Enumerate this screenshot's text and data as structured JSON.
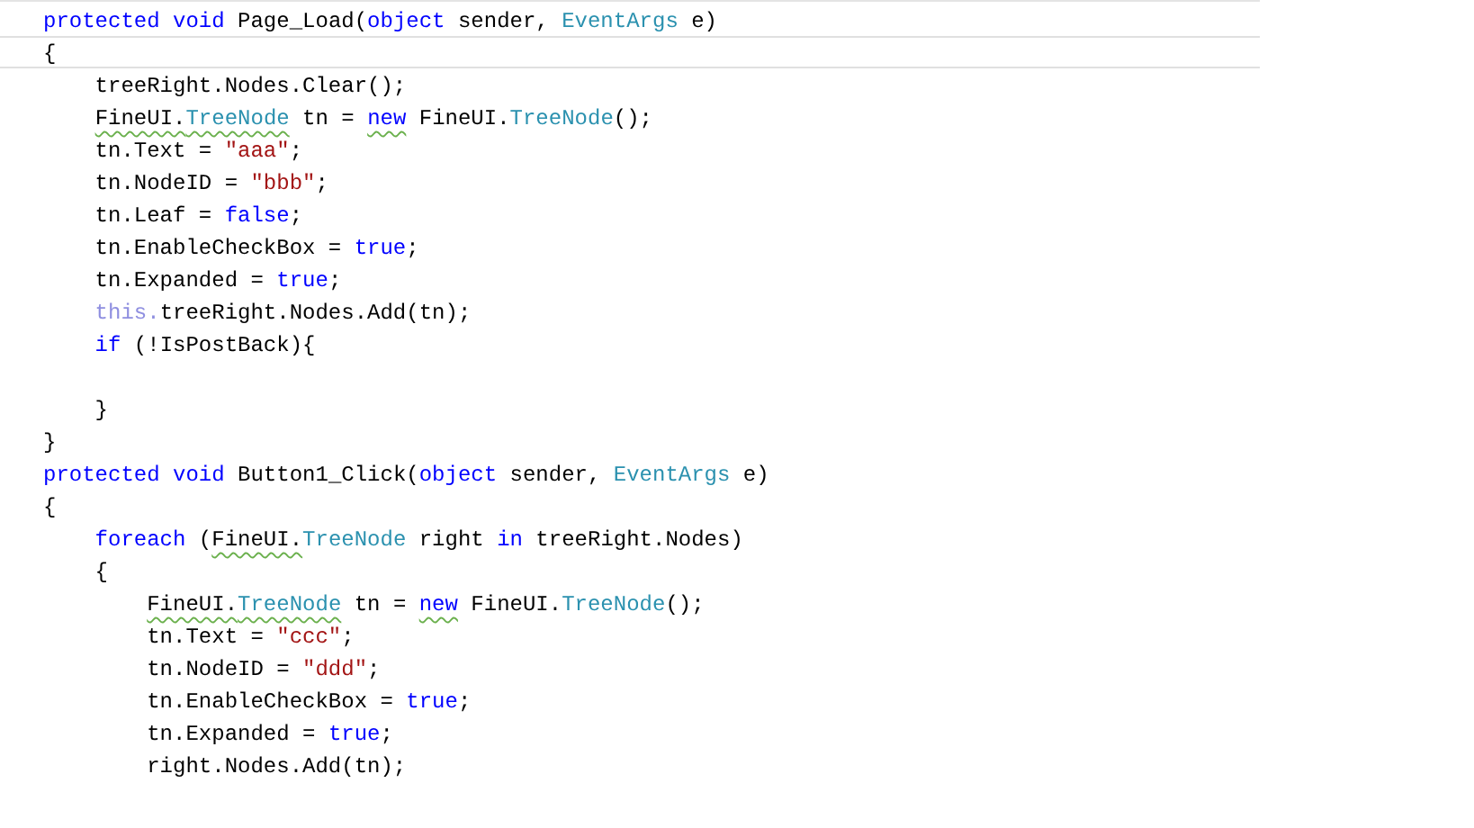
{
  "editor": {
    "lines": [
      {
        "kind": "code",
        "current": false,
        "tokens": [
          {
            "text": "protected void",
            "kind": "keyword"
          },
          {
            "text": " Page_Load(",
            "kind": "plain"
          },
          {
            "text": "object",
            "kind": "keyword"
          },
          {
            "text": " sender, ",
            "kind": "plain"
          },
          {
            "text": "EventArgs",
            "kind": "type"
          },
          {
            "text": " e)",
            "kind": "plain"
          }
        ]
      },
      {
        "kind": "code",
        "current": true,
        "tokens": [
          {
            "text": "{",
            "kind": "plain"
          }
        ]
      },
      {
        "kind": "code",
        "current": false,
        "tokens": [
          {
            "text": "    treeRight.Nodes.Clear();",
            "kind": "plain"
          }
        ]
      },
      {
        "kind": "code",
        "current": false,
        "tokens": [
          {
            "text": "    FineUI.",
            "kind": "plain",
            "squiggle": true
          },
          {
            "text": "TreeNode",
            "kind": "type",
            "squiggle": true
          },
          {
            "text": " tn = ",
            "kind": "plain"
          },
          {
            "text": "new",
            "kind": "keyword",
            "squiggle": true
          },
          {
            "text": " FineUI.",
            "kind": "plain"
          },
          {
            "text": "TreeNode",
            "kind": "type"
          },
          {
            "text": "();",
            "kind": "plain"
          }
        ]
      },
      {
        "kind": "code",
        "current": false,
        "tokens": [
          {
            "text": "    tn.Text = ",
            "kind": "plain"
          },
          {
            "text": "\"aaa\"",
            "kind": "string"
          },
          {
            "text": ";",
            "kind": "plain"
          }
        ]
      },
      {
        "kind": "code",
        "current": false,
        "tokens": [
          {
            "text": "    tn.NodeID = ",
            "kind": "plain"
          },
          {
            "text": "\"bbb\"",
            "kind": "string"
          },
          {
            "text": ";",
            "kind": "plain"
          }
        ]
      },
      {
        "kind": "code",
        "current": false,
        "tokens": [
          {
            "text": "    tn.Leaf = ",
            "kind": "plain"
          },
          {
            "text": "false",
            "kind": "keyword"
          },
          {
            "text": ";",
            "kind": "plain"
          }
        ]
      },
      {
        "kind": "code",
        "current": false,
        "tokens": [
          {
            "text": "    tn.EnableCheckBox = ",
            "kind": "plain"
          },
          {
            "text": "true",
            "kind": "keyword"
          },
          {
            "text": ";",
            "kind": "plain"
          }
        ]
      },
      {
        "kind": "code",
        "current": false,
        "tokens": [
          {
            "text": "    tn.Expanded = ",
            "kind": "plain"
          },
          {
            "text": "true",
            "kind": "keyword"
          },
          {
            "text": ";",
            "kind": "plain"
          }
        ]
      },
      {
        "kind": "code",
        "current": false,
        "tokens": [
          {
            "text": "    this.",
            "kind": "faded"
          },
          {
            "text": "treeRight.Nodes.Add(tn);",
            "kind": "plain"
          }
        ]
      },
      {
        "kind": "code",
        "current": false,
        "tokens": [
          {
            "text": "    if",
            "kind": "keyword"
          },
          {
            "text": " (!IsPostBack){",
            "kind": "plain"
          }
        ]
      },
      {
        "kind": "blank"
      },
      {
        "kind": "code",
        "current": false,
        "tokens": [
          {
            "text": "    }",
            "kind": "plain"
          }
        ]
      },
      {
        "kind": "code",
        "current": false,
        "tokens": [
          {
            "text": "}",
            "kind": "plain"
          }
        ]
      },
      {
        "kind": "code",
        "current": false,
        "tokens": [
          {
            "text": "protected void",
            "kind": "keyword"
          },
          {
            "text": " Button1_Click(",
            "kind": "plain"
          },
          {
            "text": "object",
            "kind": "keyword"
          },
          {
            "text": " sender, ",
            "kind": "plain"
          },
          {
            "text": "EventArgs",
            "kind": "type"
          },
          {
            "text": " e)",
            "kind": "plain"
          }
        ]
      },
      {
        "kind": "code",
        "current": false,
        "tokens": [
          {
            "text": "{",
            "kind": "plain"
          }
        ]
      },
      {
        "kind": "code",
        "current": false,
        "tokens": [
          {
            "text": "    foreach",
            "kind": "keyword"
          },
          {
            "text": " (",
            "kind": "plain"
          },
          {
            "text": "FineUI.",
            "kind": "plain",
            "squiggle": true
          },
          {
            "text": "TreeNode",
            "kind": "type"
          },
          {
            "text": " right ",
            "kind": "plain"
          },
          {
            "text": "in",
            "kind": "keyword"
          },
          {
            "text": " treeRight.Nodes)",
            "kind": "plain"
          }
        ]
      },
      {
        "kind": "code",
        "current": false,
        "tokens": [
          {
            "text": "    {",
            "kind": "plain"
          }
        ]
      },
      {
        "kind": "code",
        "current": false,
        "tokens": [
          {
            "text": "        FineUI.",
            "kind": "plain",
            "squiggle": true
          },
          {
            "text": "TreeNode",
            "kind": "type",
            "squiggle": true
          },
          {
            "text": " tn = ",
            "kind": "plain"
          },
          {
            "text": "new",
            "kind": "keyword",
            "squiggle": true
          },
          {
            "text": " FineUI.",
            "kind": "plain"
          },
          {
            "text": "TreeNode",
            "kind": "type"
          },
          {
            "text": "();",
            "kind": "plain"
          }
        ]
      },
      {
        "kind": "code",
        "current": false,
        "tokens": [
          {
            "text": "        tn.Text = ",
            "kind": "plain"
          },
          {
            "text": "\"ccc\"",
            "kind": "string"
          },
          {
            "text": ";",
            "kind": "plain"
          }
        ]
      },
      {
        "kind": "code",
        "current": false,
        "tokens": [
          {
            "text": "        tn.NodeID = ",
            "kind": "plain"
          },
          {
            "text": "\"ddd\"",
            "kind": "string"
          },
          {
            "text": ";",
            "kind": "plain"
          }
        ]
      },
      {
        "kind": "code",
        "current": false,
        "tokens": [
          {
            "text": "        tn.EnableCheckBox = ",
            "kind": "plain"
          },
          {
            "text": "true",
            "kind": "keyword"
          },
          {
            "text": ";",
            "kind": "plain"
          }
        ]
      },
      {
        "kind": "code",
        "current": false,
        "tokens": [
          {
            "text": "        tn.Expanded = ",
            "kind": "plain"
          },
          {
            "text": "true",
            "kind": "keyword"
          },
          {
            "text": ";",
            "kind": "plain"
          }
        ]
      },
      {
        "kind": "code",
        "current": false,
        "tokens": [
          {
            "text": "        right.Nodes.Add(tn);",
            "kind": "plain"
          }
        ]
      }
    ]
  }
}
